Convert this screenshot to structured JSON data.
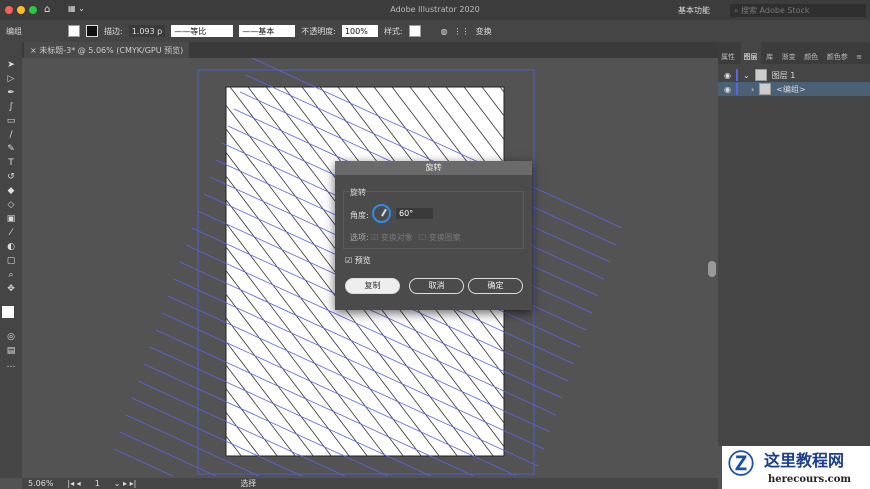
{
  "app": {
    "title": "Adobe Illustrator 2020",
    "workspace": "基本功能",
    "search_placeholder": "搜索 Adobe Stock"
  },
  "control": {
    "selection": "编组",
    "stroke_label": "描边:",
    "stroke_value": "1.093 p",
    "profile1": "等比",
    "profile2": "基本",
    "opacity_label": "不透明度:",
    "opacity_value": "100%",
    "style_label": "样式:",
    "transform": "变换"
  },
  "document": {
    "tab": "未标题-3* @ 5.06% (CMYK/GPU 预览)"
  },
  "status": {
    "zoom": "5.06%",
    "page": "1",
    "tool": "选择"
  },
  "panel": {
    "tabs": [
      "属性",
      "图层",
      "库",
      "渐变",
      "颜色",
      "颜色参"
    ],
    "layers": [
      {
        "name": "图层 1"
      },
      {
        "name": "<编组>"
      }
    ]
  },
  "dialog": {
    "title": "旋转",
    "group": "旋转",
    "angle_label": "角度:",
    "angle_value": "60°",
    "options_label": "选项:",
    "opt_objects": "变换对象",
    "opt_patterns": "变换图案",
    "preview": "预览",
    "copy": "复制",
    "cancel": "取消",
    "ok": "确定"
  },
  "watermark": {
    "text": "这里教程网",
    "url": "herecours.com"
  },
  "colors": {
    "selection": "#4f5fe0",
    "accent": "#2d8ceb"
  }
}
